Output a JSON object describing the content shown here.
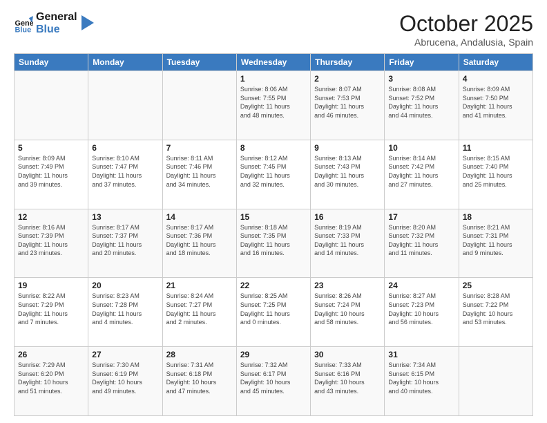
{
  "header": {
    "logo_line1": "General",
    "logo_line2": "Blue",
    "month_title": "October 2025",
    "location": "Abrucena, Andalusia, Spain"
  },
  "days_of_week": [
    "Sunday",
    "Monday",
    "Tuesday",
    "Wednesday",
    "Thursday",
    "Friday",
    "Saturday"
  ],
  "weeks": [
    [
      {
        "day": "",
        "info": ""
      },
      {
        "day": "",
        "info": ""
      },
      {
        "day": "",
        "info": ""
      },
      {
        "day": "1",
        "info": "Sunrise: 8:06 AM\nSunset: 7:55 PM\nDaylight: 11 hours\nand 48 minutes."
      },
      {
        "day": "2",
        "info": "Sunrise: 8:07 AM\nSunset: 7:53 PM\nDaylight: 11 hours\nand 46 minutes."
      },
      {
        "day": "3",
        "info": "Sunrise: 8:08 AM\nSunset: 7:52 PM\nDaylight: 11 hours\nand 44 minutes."
      },
      {
        "day": "4",
        "info": "Sunrise: 8:09 AM\nSunset: 7:50 PM\nDaylight: 11 hours\nand 41 minutes."
      }
    ],
    [
      {
        "day": "5",
        "info": "Sunrise: 8:09 AM\nSunset: 7:49 PM\nDaylight: 11 hours\nand 39 minutes."
      },
      {
        "day": "6",
        "info": "Sunrise: 8:10 AM\nSunset: 7:47 PM\nDaylight: 11 hours\nand 37 minutes."
      },
      {
        "day": "7",
        "info": "Sunrise: 8:11 AM\nSunset: 7:46 PM\nDaylight: 11 hours\nand 34 minutes."
      },
      {
        "day": "8",
        "info": "Sunrise: 8:12 AM\nSunset: 7:45 PM\nDaylight: 11 hours\nand 32 minutes."
      },
      {
        "day": "9",
        "info": "Sunrise: 8:13 AM\nSunset: 7:43 PM\nDaylight: 11 hours\nand 30 minutes."
      },
      {
        "day": "10",
        "info": "Sunrise: 8:14 AM\nSunset: 7:42 PM\nDaylight: 11 hours\nand 27 minutes."
      },
      {
        "day": "11",
        "info": "Sunrise: 8:15 AM\nSunset: 7:40 PM\nDaylight: 11 hours\nand 25 minutes."
      }
    ],
    [
      {
        "day": "12",
        "info": "Sunrise: 8:16 AM\nSunset: 7:39 PM\nDaylight: 11 hours\nand 23 minutes."
      },
      {
        "day": "13",
        "info": "Sunrise: 8:17 AM\nSunset: 7:37 PM\nDaylight: 11 hours\nand 20 minutes."
      },
      {
        "day": "14",
        "info": "Sunrise: 8:17 AM\nSunset: 7:36 PM\nDaylight: 11 hours\nand 18 minutes."
      },
      {
        "day": "15",
        "info": "Sunrise: 8:18 AM\nSunset: 7:35 PM\nDaylight: 11 hours\nand 16 minutes."
      },
      {
        "day": "16",
        "info": "Sunrise: 8:19 AM\nSunset: 7:33 PM\nDaylight: 11 hours\nand 14 minutes."
      },
      {
        "day": "17",
        "info": "Sunrise: 8:20 AM\nSunset: 7:32 PM\nDaylight: 11 hours\nand 11 minutes."
      },
      {
        "day": "18",
        "info": "Sunrise: 8:21 AM\nSunset: 7:31 PM\nDaylight: 11 hours\nand 9 minutes."
      }
    ],
    [
      {
        "day": "19",
        "info": "Sunrise: 8:22 AM\nSunset: 7:29 PM\nDaylight: 11 hours\nand 7 minutes."
      },
      {
        "day": "20",
        "info": "Sunrise: 8:23 AM\nSunset: 7:28 PM\nDaylight: 11 hours\nand 4 minutes."
      },
      {
        "day": "21",
        "info": "Sunrise: 8:24 AM\nSunset: 7:27 PM\nDaylight: 11 hours\nand 2 minutes."
      },
      {
        "day": "22",
        "info": "Sunrise: 8:25 AM\nSunset: 7:25 PM\nDaylight: 11 hours\nand 0 minutes."
      },
      {
        "day": "23",
        "info": "Sunrise: 8:26 AM\nSunset: 7:24 PM\nDaylight: 10 hours\nand 58 minutes."
      },
      {
        "day": "24",
        "info": "Sunrise: 8:27 AM\nSunset: 7:23 PM\nDaylight: 10 hours\nand 56 minutes."
      },
      {
        "day": "25",
        "info": "Sunrise: 8:28 AM\nSunset: 7:22 PM\nDaylight: 10 hours\nand 53 minutes."
      }
    ],
    [
      {
        "day": "26",
        "info": "Sunrise: 7:29 AM\nSunset: 6:20 PM\nDaylight: 10 hours\nand 51 minutes."
      },
      {
        "day": "27",
        "info": "Sunrise: 7:30 AM\nSunset: 6:19 PM\nDaylight: 10 hours\nand 49 minutes."
      },
      {
        "day": "28",
        "info": "Sunrise: 7:31 AM\nSunset: 6:18 PM\nDaylight: 10 hours\nand 47 minutes."
      },
      {
        "day": "29",
        "info": "Sunrise: 7:32 AM\nSunset: 6:17 PM\nDaylight: 10 hours\nand 45 minutes."
      },
      {
        "day": "30",
        "info": "Sunrise: 7:33 AM\nSunset: 6:16 PM\nDaylight: 10 hours\nand 43 minutes."
      },
      {
        "day": "31",
        "info": "Sunrise: 7:34 AM\nSunset: 6:15 PM\nDaylight: 10 hours\nand 40 minutes."
      },
      {
        "day": "",
        "info": ""
      }
    ]
  ]
}
